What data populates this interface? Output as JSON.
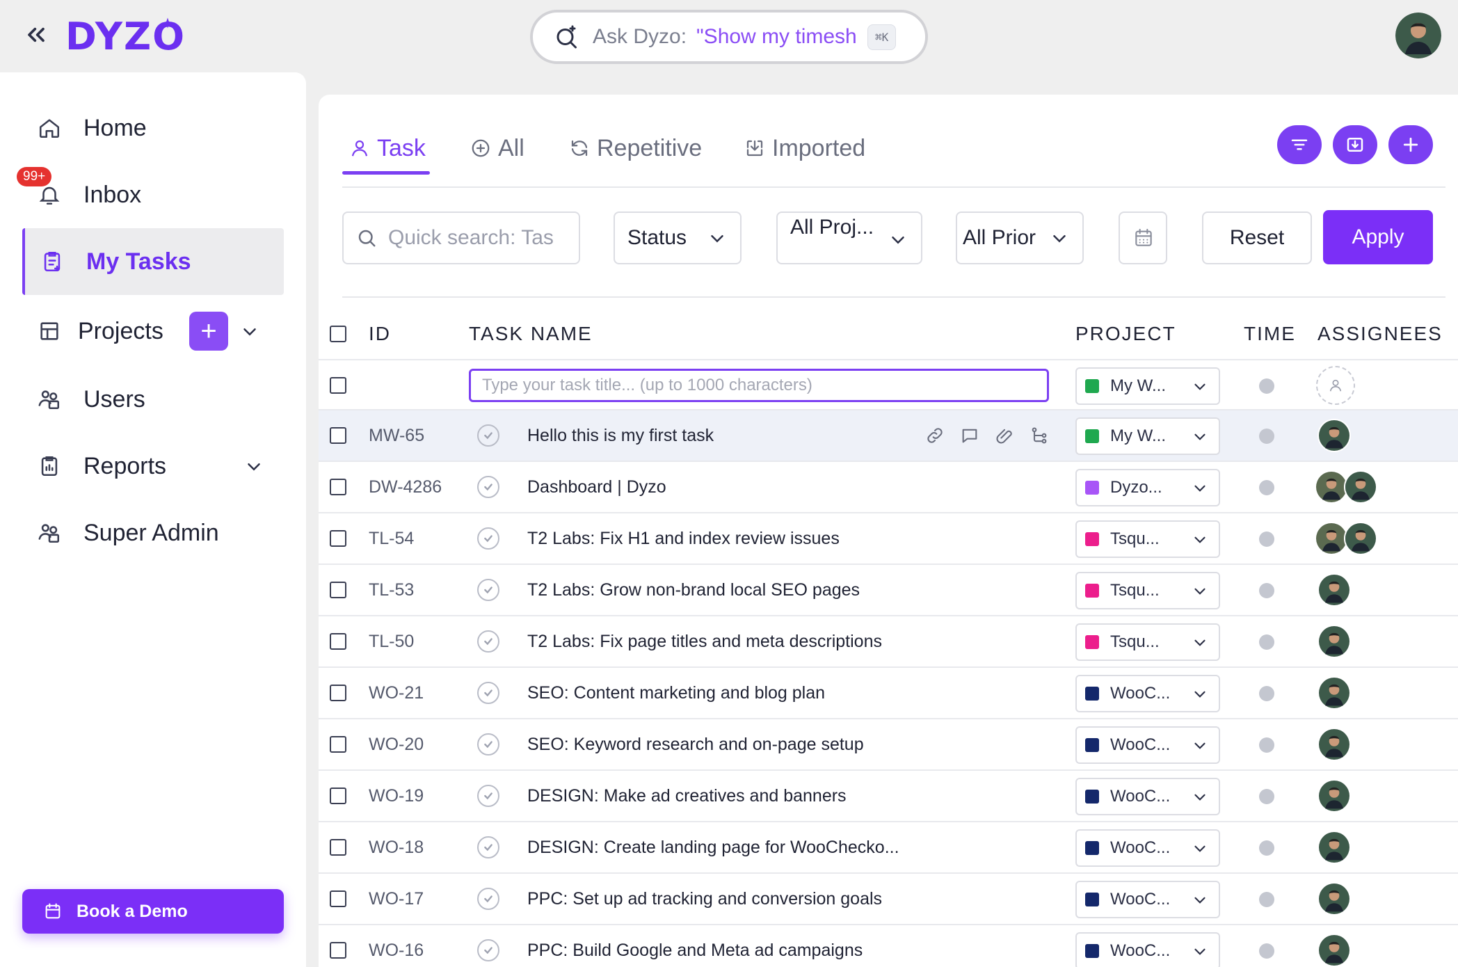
{
  "header": {
    "logo": "DYZO",
    "ask_label": "Ask Dyzo:",
    "ask_hint": "\"Show my timesh",
    "ask_shortcut": "⌘K"
  },
  "sidebar": {
    "items": [
      {
        "label": "Home"
      },
      {
        "label": "Inbox",
        "badge": "99+"
      },
      {
        "label": "My Tasks"
      },
      {
        "label": "Projects"
      },
      {
        "label": "Users"
      },
      {
        "label": "Reports"
      },
      {
        "label": "Super Admin"
      }
    ],
    "book_demo": "Book a Demo"
  },
  "tabs": [
    {
      "label": "Task"
    },
    {
      "label": "All"
    },
    {
      "label": "Repetitive"
    },
    {
      "label": "Imported"
    }
  ],
  "filters": {
    "search_placeholder": "Quick search: Tas",
    "status": "Status",
    "project": "All Proj...",
    "priority": "All Prior",
    "reset": "Reset",
    "apply": "Apply"
  },
  "table": {
    "headers": [
      "ID",
      "TASK NAME",
      "PROJECT",
      "TIME",
      "ASSIGNEES"
    ],
    "new_task_placeholder": "Type your task title... (up to 1000 characters)",
    "new_task_project": "My W...",
    "rows": [
      {
        "id": "MW-65",
        "name": "Hello this is my first task",
        "project": "My W...",
        "project_color": "#1fa84f"
      },
      {
        "id": "DW-4286",
        "name": "Dashboard | Dyzo",
        "project": "Dyzo...",
        "project_color": "#a855f7"
      },
      {
        "id": "TL-54",
        "name": "T2 Labs: Fix H1 and index review issues",
        "project": "Tsqu...",
        "project_color": "#ec1e8c"
      },
      {
        "id": "TL-53",
        "name": "T2 Labs: Grow non-brand local SEO pages",
        "project": "Tsqu...",
        "project_color": "#ec1e8c"
      },
      {
        "id": "TL-50",
        "name": "T2 Labs: Fix page titles and meta descriptions",
        "project": "Tsqu...",
        "project_color": "#ec1e8c"
      },
      {
        "id": "WO-21",
        "name": "SEO: Content marketing and blog plan",
        "project": "WooC...",
        "project_color": "#14286b"
      },
      {
        "id": "WO-20",
        "name": "SEO: Keyword research and on-page setup",
        "project": "WooC...",
        "project_color": "#14286b"
      },
      {
        "id": "WO-19",
        "name": "DESIGN: Make ad creatives and banners",
        "project": "WooC...",
        "project_color": "#14286b"
      },
      {
        "id": "WO-18",
        "name": "DESIGN: Create landing page for WooChecko...",
        "project": "WooC...",
        "project_color": "#14286b"
      },
      {
        "id": "WO-17",
        "name": "PPC: Set up ad tracking and conversion goals",
        "project": "WooC...",
        "project_color": "#14286b"
      },
      {
        "id": "WO-16",
        "name": "PPC: Build Google and Meta ad campaigns",
        "project": "WooC...",
        "project_color": "#14286b"
      }
    ]
  },
  "colors": {
    "accent": "#7b3ff2",
    "badge": "#e5322f"
  }
}
